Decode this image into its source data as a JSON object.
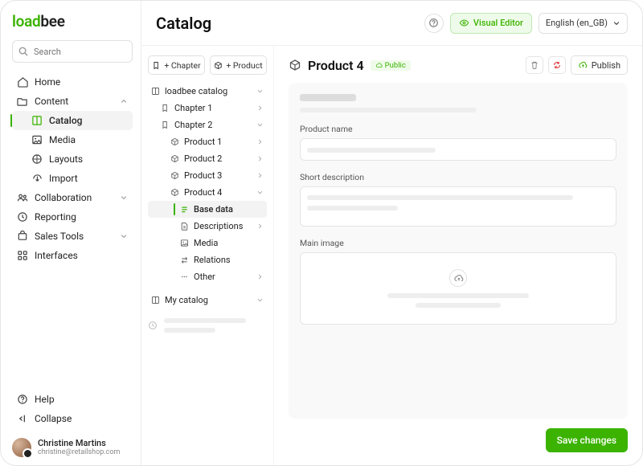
{
  "logo": {
    "a": "load",
    "b": "bee"
  },
  "search": {
    "placeholder": "Search"
  },
  "nav": {
    "home": "Home",
    "content": "Content",
    "catalog": "Catalog",
    "media": "Media",
    "layouts": "Layouts",
    "import": "Import",
    "collaboration": "Collaboration",
    "reporting": "Reporting",
    "sales_tools": "Sales Tools",
    "interfaces": "Interfaces",
    "help": "Help",
    "collapse": "Collapse"
  },
  "user": {
    "name": "Christine Martins",
    "email": "christine@retailshop.com"
  },
  "page": {
    "title": "Catalog"
  },
  "topbar": {
    "visual_editor": "Visual Editor",
    "language": "English (en_GB)"
  },
  "tree_panel": {
    "add_chapter": "+ Chapter",
    "add_product": "+ Product",
    "nodes": {
      "root": "loadbee catalog",
      "chapter1": "Chapter 1",
      "chapter2": "Chapter 2",
      "product1": "Product 1",
      "product2": "Product 2",
      "product3": "Product 3",
      "product4": "Product 4",
      "base_data": "Base data",
      "descriptions": "Descriptions",
      "media": "Media",
      "relations": "Relations",
      "other": "Other",
      "my_catalog": "My catalog"
    }
  },
  "editor": {
    "title": "Product 4",
    "badge": "Public",
    "publish": "Publish",
    "fields": {
      "product_name": "Product name",
      "short_description": "Short description",
      "main_image": "Main image"
    },
    "save": "Save changes"
  }
}
